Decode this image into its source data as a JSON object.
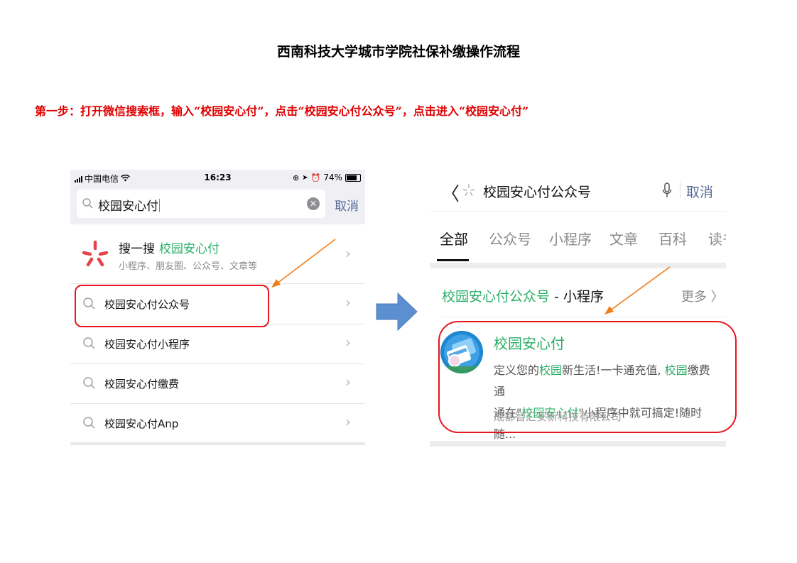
{
  "document": {
    "title": "西南科技大学城市学院社保补缴操作流程",
    "step1": "第一步：打开微信搜索框，输入“校园安心付”，点击“校园安心付公众号”，点击进入“校园安心付”"
  },
  "left_screen": {
    "status": {
      "carrier": "中国电信",
      "time": "16:23",
      "battery": "74%"
    },
    "search_query": "校园安心付",
    "cancel": "取消",
    "souyisou": {
      "label": "搜一搜",
      "keyword": "校园安心付",
      "subtitle": "小程序、朋友圈、公众号、文章等"
    },
    "suggestions": [
      "校园安心付公众号",
      "校园安心付小程序",
      "校园安心付缴费",
      "校园安心付Anp"
    ]
  },
  "right_screen": {
    "search_query": "校园安心付公众号",
    "cancel": "取消",
    "tabs": [
      "全部",
      "公众号",
      "小程序",
      "文章",
      "百科",
      "读书"
    ],
    "active_tab": "全部",
    "section": {
      "keyword": "校园安心付公众号",
      "suffix": " - 小程序",
      "more": "更多 〉"
    },
    "result": {
      "title": "校园安心付",
      "desc_line1": [
        {
          "t": "定义您的",
          "hl": false
        },
        {
          "t": "校园",
          "hl": true
        },
        {
          "t": "新生活!一卡通充值, ",
          "hl": false
        },
        {
          "t": "校园",
          "hl": true
        },
        {
          "t": "缴费通",
          "hl": false
        }
      ],
      "desc_line2": [
        {
          "t": "通在\"",
          "hl": false
        },
        {
          "t": "校园安心付",
          "hl": true
        },
        {
          "t": "\"小程序中就可搞定!随时随...",
          "hl": false
        }
      ],
      "company": "成都智汇安新科技有限公司"
    }
  },
  "colors": {
    "step_text": "#e00000",
    "highlight_box": "#e8141c",
    "arrow_orange": "#f07d1a",
    "big_arrow": "#5b8fd0",
    "wechat_green": "#2aae67",
    "link_blue": "#576b95"
  }
}
